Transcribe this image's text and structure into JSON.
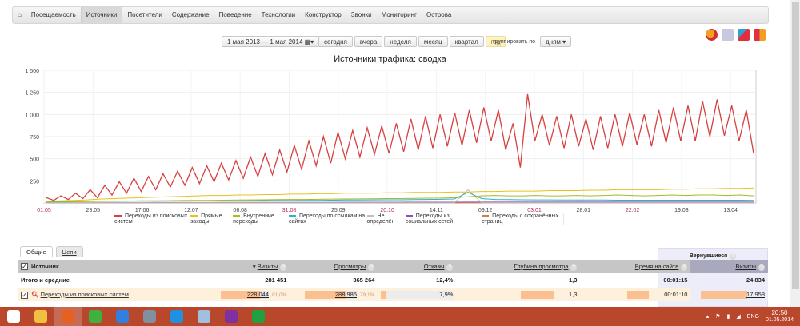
{
  "nav": {
    "items": [
      "Посещаемость",
      "Источники",
      "Посетители",
      "Содержание",
      "Поведение",
      "Технологии",
      "Конструктор",
      "Звонки",
      "Мониторинг",
      "Острова"
    ],
    "active": "Источники"
  },
  "controls": {
    "date_range": "1 мая 2013 — 1 мая 2014",
    "periods": [
      "сегодня",
      "вчера",
      "неделя",
      "месяц",
      "квартал",
      "год"
    ],
    "selected_period": "год",
    "group_label": "группировать по",
    "group_value": "дням"
  },
  "chart_types": [
    "pie-chart-icon",
    "line-chart-icon",
    "area-chart-icon",
    "stacked-chart-icon"
  ],
  "chart_data": {
    "type": "line",
    "title": "Источники трафика: сводка",
    "x_range": [
      "01.05.2013",
      "01.05.2014"
    ],
    "x_ticks": [
      "01.05",
      "23.05",
      "17.06",
      "12.07",
      "06.08",
      "31.08",
      "25.09",
      "20.10",
      "14.11",
      "09.12",
      "03.01",
      "28.01",
      "22.02",
      "19.03",
      "13.04"
    ],
    "y_ticks": [
      "250",
      "500",
      "750",
      "1 000",
      "1 250",
      "1 500"
    ],
    "ylim": [
      0,
      1500
    ],
    "grid": true,
    "legend": "bottom",
    "series": [
      {
        "name": "Переходы из поисковых систем",
        "color": "#d64040",
        "values": [
          60,
          30,
          80,
          40,
          110,
          50,
          150,
          60,
          200,
          90,
          240,
          110,
          280,
          130,
          300,
          150,
          330,
          180,
          360,
          200,
          400,
          220,
          420,
          240,
          450,
          260,
          480,
          280,
          520,
          300,
          560,
          320,
          600,
          350,
          650,
          380,
          700,
          420,
          750,
          450,
          800,
          500,
          820,
          520,
          850,
          550,
          870,
          560,
          900,
          580,
          950,
          600,
          980,
          620,
          1000,
          640,
          1020,
          650,
          1050,
          680,
          1080,
          700,
          1050,
          600,
          900,
          400,
          1230,
          700,
          1000,
          650,
          980,
          620,
          1000,
          640,
          950,
          600,
          980,
          620,
          1000,
          640,
          1020,
          660,
          1000,
          640,
          1050,
          680,
          1080,
          700,
          1100,
          700,
          1150,
          750,
          1170,
          760,
          1100,
          700,
          1050,
          560
        ]
      },
      {
        "name": "Прямые заходы",
        "color": "#e8c020",
        "values": [
          20,
          25,
          30,
          35,
          45,
          50,
          55,
          60,
          65,
          70,
          75,
          80,
          85,
          85,
          90,
          90,
          95,
          95,
          100,
          100,
          105,
          105,
          110,
          110,
          110,
          115,
          115,
          120,
          120,
          120,
          125,
          125,
          130,
          130,
          135,
          135,
          135,
          140,
          140,
          140,
          145,
          145,
          150,
          150,
          150,
          150,
          155,
          155,
          160,
          160,
          165,
          165,
          170
        ]
      },
      {
        "name": "Внутренние переходы",
        "color": "#9cc020",
        "values": [
          10,
          12,
          14,
          16,
          18,
          20,
          22,
          24,
          25,
          26,
          28,
          30,
          30,
          32,
          34,
          35,
          36,
          38,
          40,
          40,
          42,
          44,
          45,
          46,
          48,
          50,
          50,
          52,
          54,
          55,
          60,
          70,
          80,
          85,
          80,
          80,
          85,
          80,
          80,
          85,
          80,
          85,
          90,
          85,
          80,
          85,
          90,
          85,
          90,
          90,
          85,
          90,
          80
        ]
      },
      {
        "name": "Переходы по ссылкам на сайтах",
        "color": "#30b0d0",
        "values": [
          15,
          16,
          17,
          18,
          18,
          19,
          20,
          20,
          21,
          22,
          22,
          23,
          24,
          25,
          25,
          26,
          27,
          28,
          28,
          30,
          30,
          32,
          33,
          34,
          35,
          36,
          36,
          38,
          40,
          42,
          45,
          120,
          50,
          40,
          38,
          36,
          35,
          35,
          34,
          34,
          33,
          33,
          32,
          32,
          32,
          32,
          32,
          32,
          32,
          32,
          32,
          32,
          30
        ]
      },
      {
        "name": "Не определён",
        "color": "#c0c0c0",
        "values": [
          2,
          2,
          2,
          2,
          2,
          2,
          2,
          2,
          2,
          2,
          2,
          2,
          2,
          2,
          2,
          2,
          2,
          2,
          2,
          2,
          2,
          2,
          2,
          2,
          2,
          2,
          2,
          2,
          2,
          2,
          2,
          150,
          3,
          3,
          3,
          3,
          3,
          3,
          3,
          3,
          3,
          3,
          3,
          3,
          3,
          3,
          3,
          3,
          3,
          3,
          3,
          3,
          3
        ]
      },
      {
        "name": "Переходы из социальных сетей",
        "color": "#9050b0",
        "values": [
          3,
          3,
          3,
          3,
          4,
          4,
          4,
          4,
          5,
          5,
          5,
          5,
          5,
          6,
          6,
          6,
          6,
          6,
          7,
          7,
          7,
          7,
          8,
          8,
          8,
          8,
          8,
          9,
          9,
          9,
          9,
          10,
          10,
          10,
          10,
          10,
          10,
          10,
          10,
          10,
          10,
          10,
          10,
          10,
          10,
          10,
          10,
          10,
          10,
          10,
          10,
          10,
          10
        ]
      },
      {
        "name": "Переходы с сохранённых страниц",
        "color": "#d08040",
        "values": [
          1,
          1,
          1,
          1,
          1,
          1,
          1,
          1,
          1,
          1,
          1,
          1,
          1,
          1,
          1,
          1,
          1,
          1,
          1,
          1,
          1,
          1,
          1,
          1,
          1,
          1,
          1,
          1,
          1,
          1,
          1,
          1,
          1,
          1,
          1,
          1,
          1,
          1,
          1,
          1,
          1,
          1,
          1,
          1,
          1,
          1,
          1,
          1,
          1,
          1,
          1,
          1,
          1
        ]
      }
    ]
  },
  "table": {
    "tabs": [
      "Общие",
      "Цепи"
    ],
    "returning_label": "Вернувшиеся",
    "headers": {
      "source": "Источник",
      "visits": "Визиты",
      "views": "Просмотры",
      "bounces": "Отказы",
      "depth": "Глубина просмотра",
      "time": "Время на сайте",
      "ret_visits": "Визиты"
    },
    "totals": {
      "label": "Итого и средние",
      "visits": "281 451",
      "views": "365 264",
      "bounces": "12,4%",
      "depth": "1,3",
      "time": "00:01:15",
      "ret_visits": "24 834"
    },
    "rows": [
      {
        "label": "Переходы из поисковых систем",
        "visits": "228 044",
        "visits_pct": "81,0%",
        "views": "288 985",
        "views_pct": "79,1%",
        "bounces": "7,9%",
        "depth": "1,3",
        "time": "00:01:10",
        "ret_visits": "17 958"
      }
    ]
  },
  "taskbar": {
    "apps": [
      "start-icon",
      "explorer-icon",
      "firefox-icon",
      "icq-icon",
      "ie-icon",
      "media-icon",
      "skype-icon",
      "notepad-icon",
      "winrar-icon",
      "excel-icon"
    ],
    "lang": "ENG",
    "time": "20:50",
    "date": "01.05.2014"
  }
}
